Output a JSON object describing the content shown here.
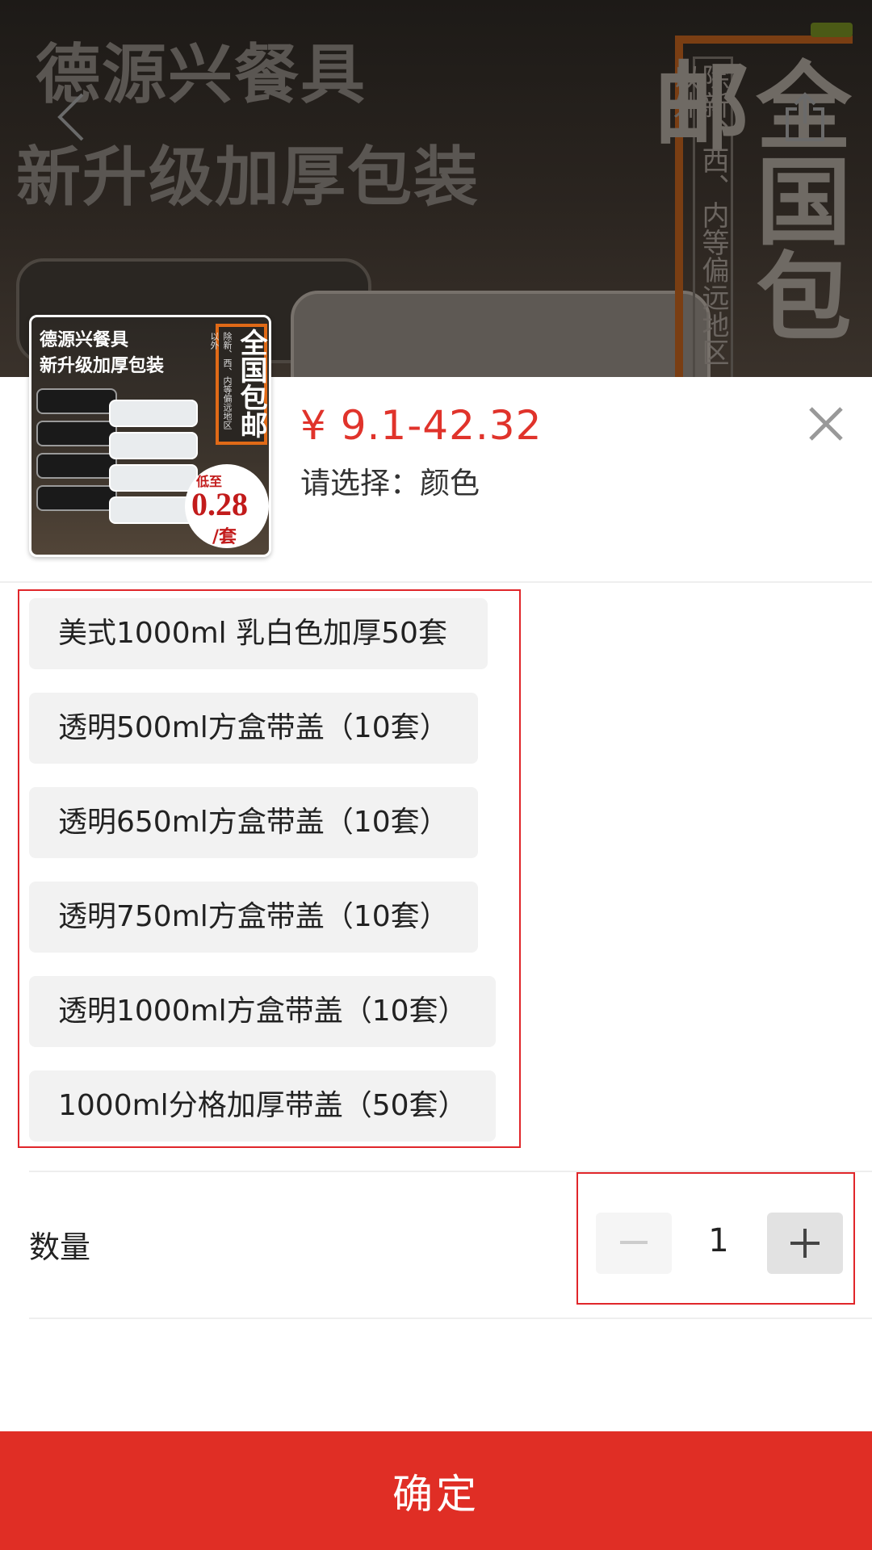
{
  "banner": {
    "headline_line1": "德源兴餐具",
    "headline_line2": "新升级加厚包装",
    "side_note": "除新、西、内等偏远地区以外",
    "side_big": "全国包邮"
  },
  "product": {
    "thumb": {
      "line1": "德源兴餐具",
      "line2": "新升级加厚包装",
      "side_note": "除新、西、内等偏远地区以外",
      "side_big": "全国包邮",
      "badge_low": "低至",
      "badge_price": "0.28",
      "badge_unit": "/套"
    },
    "price": "¥ 9.1-42.32",
    "select_hint": "请选择：颜色"
  },
  "options": [
    "美式1000ml 乳白色加厚50套",
    "透明500ml方盒带盖（10套）",
    "透明650ml方盒带盖（10套）",
    "透明750ml方盒带盖（10套）",
    "透明1000ml方盒带盖（10套）",
    "1000ml分格加厚带盖（50套）"
  ],
  "quantity": {
    "label": "数量",
    "value": "1"
  },
  "confirm_label": "确定",
  "colors": {
    "accent": "#e02e25",
    "price": "#e0332b",
    "option_bg": "#f2f2f2",
    "highlight_border": "#e0262a"
  },
  "icons": [
    "back-arrow-icon",
    "share-icon",
    "close-icon",
    "minus-icon",
    "plus-icon"
  ]
}
